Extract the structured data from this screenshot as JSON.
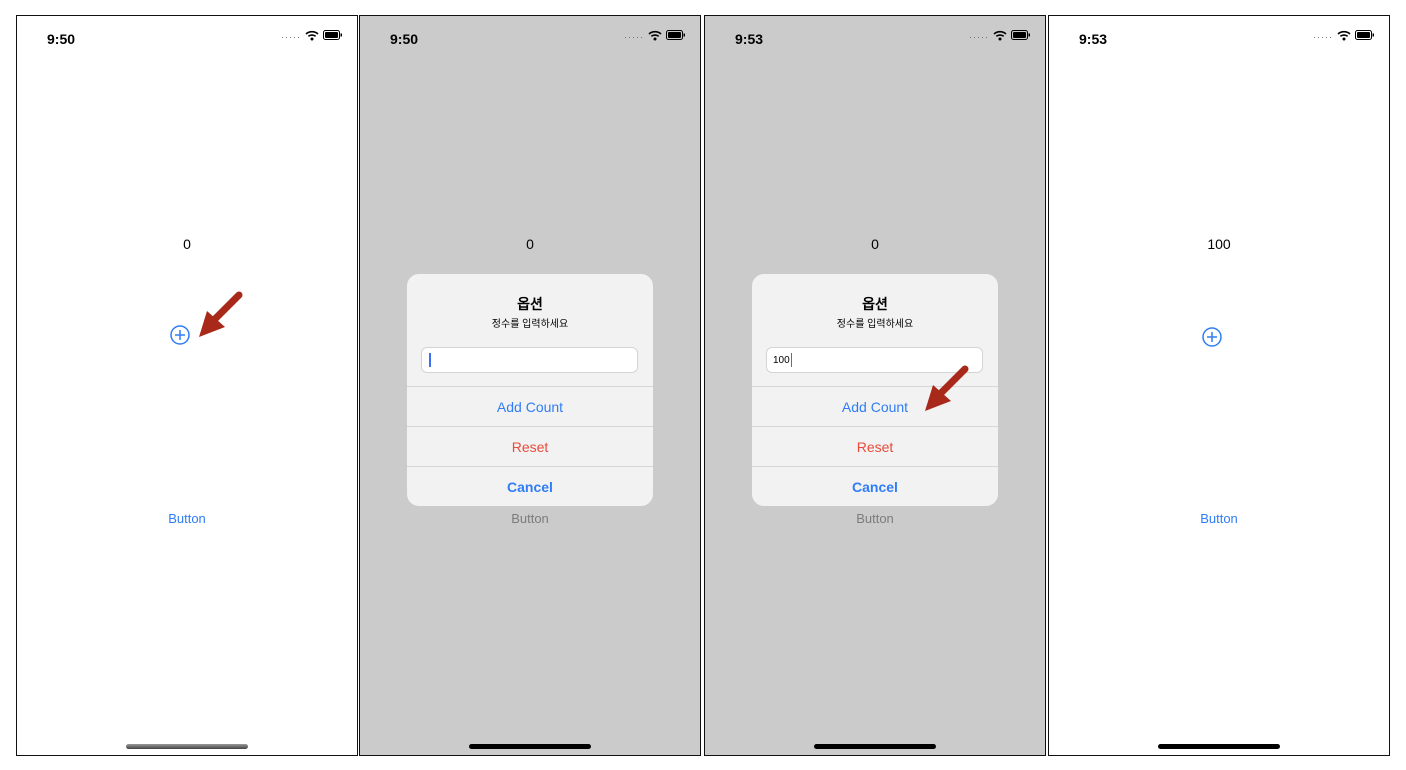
{
  "screens": [
    {
      "time": "9:50",
      "count": "0",
      "button_label": "Button"
    },
    {
      "time": "9:50",
      "count": "0",
      "button_label": "Button",
      "alert": {
        "title": "옵션",
        "message": "정수를 입력하세요",
        "input_value": "",
        "actions": [
          "Add Count",
          "Reset",
          "Cancel"
        ]
      }
    },
    {
      "time": "9:53",
      "count": "0",
      "button_label": "Button",
      "alert": {
        "title": "옵션",
        "message": "정수를 입력하세요",
        "input_value": "100",
        "actions": [
          "Add Count",
          "Reset",
          "Cancel"
        ]
      }
    },
    {
      "time": "9:53",
      "count": "100",
      "button_label": "Button"
    }
  ],
  "colors": {
    "accent": "#2f7df6",
    "destructive": "#e84b3c",
    "dim_background": "#cbcbcb",
    "annotation_arrow": "#a8281a"
  },
  "icons": {
    "add": "plus-circle-icon",
    "wifi": "wifi-icon",
    "battery": "battery-icon",
    "signal": "signal-dots-icon",
    "annotation": "arrow-icon"
  }
}
